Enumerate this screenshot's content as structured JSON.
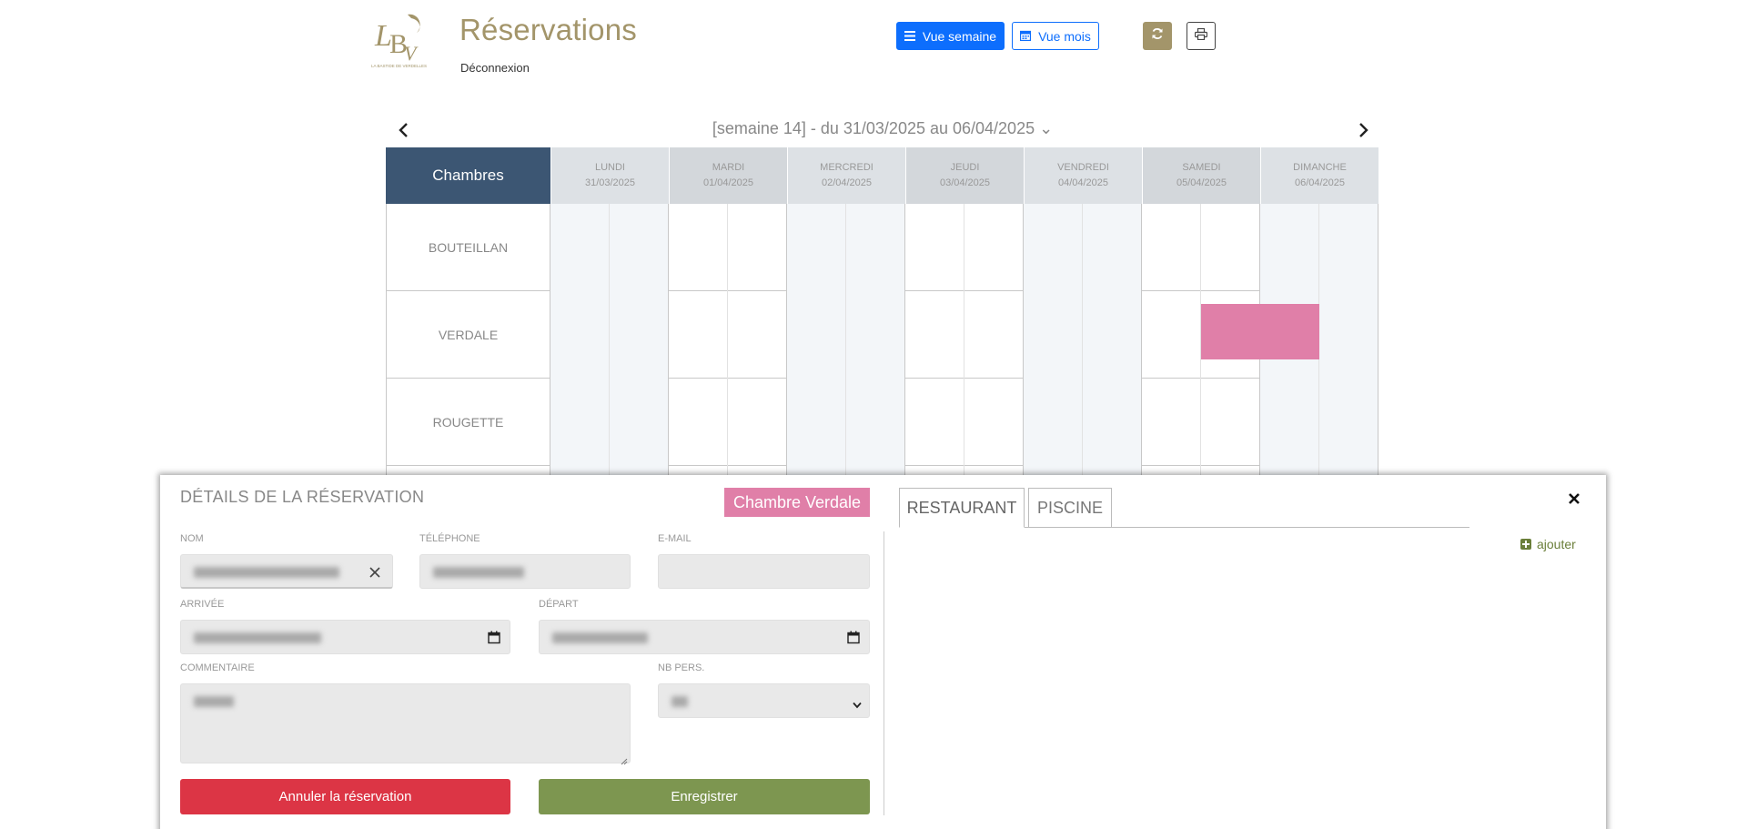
{
  "header": {
    "title": "Réservations",
    "logout_label": "Déconnexion",
    "logo_monogram": "LBV",
    "logo_tagline": "LA BASTIDE DE VERDELLES"
  },
  "toolbar": {
    "week_view_label": "Vue semaine",
    "month_view_label": "Vue mois",
    "refresh_icon": "refresh-icon",
    "print_icon": "print-icon"
  },
  "week_nav": {
    "label": "[semaine 14] - du 31/03/2025 au 06/04/2025 ⌄"
  },
  "calendar": {
    "rooms_header": "Chambres",
    "days": [
      {
        "name": "LUNDI",
        "date": "31/03/2025"
      },
      {
        "name": "MARDI",
        "date": "01/04/2025"
      },
      {
        "name": "MERCREDI",
        "date": "02/04/2025"
      },
      {
        "name": "JEUDI",
        "date": "03/04/2025"
      },
      {
        "name": "VENDREDI",
        "date": "04/04/2025"
      },
      {
        "name": "SAMEDI",
        "date": "05/04/2025"
      },
      {
        "name": "DIMANCHE",
        "date": "06/04/2025"
      }
    ],
    "rooms": [
      "BOUTEILLAN",
      "VERDALE",
      "ROUGETTE"
    ],
    "booking_color": "#e07fa8"
  },
  "details": {
    "title": "DÉTAILS DE LA RÉSERVATION",
    "room_badge": "Chambre Verdale",
    "labels": {
      "nom": "NOM",
      "telephone": "TÉLÉPHONE",
      "email": "E-MAIL",
      "arrivee": "ARRIVÉE",
      "depart": "DÉPART",
      "commentaire": "COMMENTAIRE",
      "nb_pers": "NB PERS."
    },
    "cancel_label": "Annuler la réservation",
    "save_label": "Enregistrer",
    "tabs": [
      "RESTAURANT",
      "PISCINE"
    ],
    "add_label": "ajouter"
  },
  "colors": {
    "brand_gold": "#a3956a",
    "primary_blue": "#0d6efd",
    "rooms_header_bg": "#3c5673",
    "cancel_red": "#dc3545",
    "save_green": "#7d9650"
  }
}
